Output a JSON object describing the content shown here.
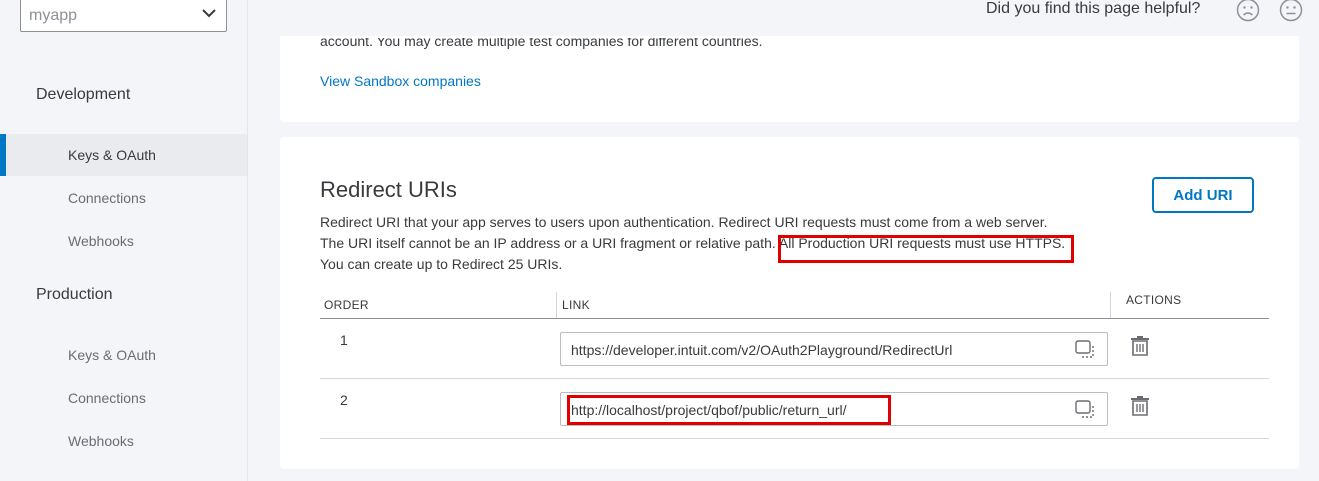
{
  "sidebar": {
    "app_select": {
      "value": "myapp"
    },
    "development": {
      "label": "Development",
      "items": [
        {
          "label": "Keys & OAuth"
        },
        {
          "label": "Connections"
        },
        {
          "label": "Webhooks"
        }
      ]
    },
    "production": {
      "label": "Production",
      "items": [
        {
          "label": "Keys & OAuth"
        },
        {
          "label": "Connections"
        },
        {
          "label": "Webhooks"
        }
      ]
    }
  },
  "feedback": {
    "question": "Did you find this page helpful?",
    "icons": [
      "sad-face-icon",
      "neutral-face-icon"
    ]
  },
  "sandbox_card": {
    "text": "account. You may create multiple test companies for different countries.",
    "link": "View Sandbox companies"
  },
  "redirect_card": {
    "title": "Redirect URIs",
    "add_button": "Add URI",
    "desc_line1": "Redirect URI that your app serves to users upon authentication. Redirect URI requests must come from a web server.",
    "desc_line2a": "The URI itself cannot be an IP address or a URI fragment or relative path.",
    "desc_line2b": "All Production URI requests must use HTTPS.",
    "desc_line3": "You can create up to Redirect 25 URIs.",
    "table": {
      "columns": [
        "ORDER",
        "LINK",
        "ACTIONS"
      ],
      "rows": [
        {
          "order": "1",
          "link": "https://developer.intuit.com/v2/OAuth2Playground/RedirectUrl"
        },
        {
          "order": "2",
          "link": "http://localhost/project/qbof/public/return_url/"
        }
      ]
    }
  },
  "colors": {
    "accent": "#0077c5",
    "annotation_red": "#e00000",
    "text": "#393a3d"
  }
}
